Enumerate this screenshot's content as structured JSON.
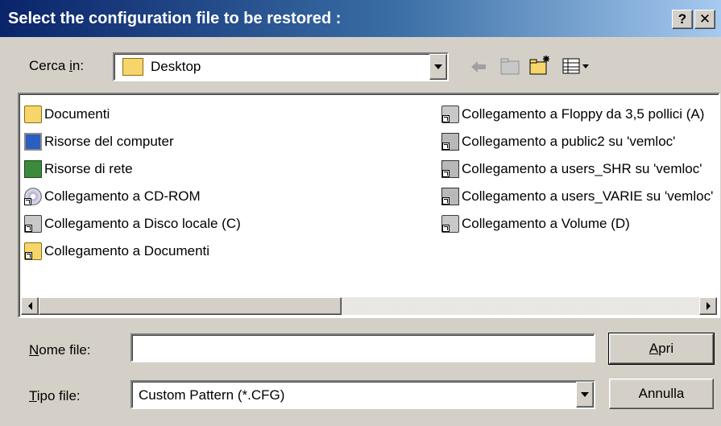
{
  "dialog": {
    "title": "Select the configuration file to be restored :",
    "help_label": "?",
    "close_label": "✕"
  },
  "lookin": {
    "label_pre": "Cerca ",
    "label_key": "i",
    "label_post": "n:",
    "value": "Desktop"
  },
  "toolbar": {
    "back_icon": "back-arrow-icon",
    "up_icon": "up-folder-icon",
    "newfolder_icon": "new-folder-icon",
    "view_icon": "view-menu-icon"
  },
  "files": {
    "left": [
      {
        "label": "Documenti",
        "icon": "documents-folder-icon"
      },
      {
        "label": "Risorse del computer",
        "icon": "my-computer-icon"
      },
      {
        "label": "Risorse di rete",
        "icon": "network-places-icon"
      },
      {
        "label": "Collegamento a CD-ROM",
        "icon": "cdrom-shortcut-icon"
      },
      {
        "label": "Collegamento a Disco locale (C)",
        "icon": "local-disk-shortcut-icon"
      },
      {
        "label": "Collegamento a Documenti",
        "icon": "folder-shortcut-icon"
      }
    ],
    "right": [
      {
        "label": "Collegamento a Floppy da 3,5 pollici (A)",
        "icon": "floppy-shortcut-icon"
      },
      {
        "label": "Collegamento a public2 su 'vemloc'",
        "icon": "network-drive-shortcut-icon"
      },
      {
        "label": "Collegamento a users_SHR su 'vemloc'",
        "icon": "network-drive-shortcut-icon"
      },
      {
        "label": "Collegamento a users_VARIE su 'vemloc'",
        "icon": "network-drive-shortcut-icon"
      },
      {
        "label": "Collegamento a Volume (D)",
        "icon": "drive-shortcut-icon"
      }
    ]
  },
  "filename": {
    "label_key": "N",
    "label_rest": "ome file:",
    "value": ""
  },
  "filetype": {
    "label_key": "T",
    "label_rest": "ipo file:",
    "value": "Custom Pattern (*.CFG)"
  },
  "buttons": {
    "open_key": "A",
    "open_rest": "pri",
    "cancel": "Annulla"
  }
}
